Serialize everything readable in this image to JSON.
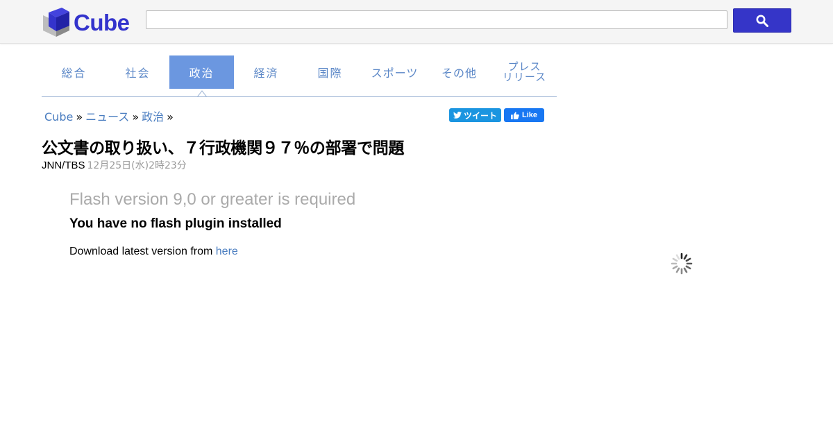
{
  "header": {
    "logo_text": "Cube",
    "search": {
      "value": "",
      "placeholder": ""
    },
    "brand_color": "#3535c8"
  },
  "nav": {
    "tabs": [
      {
        "label": "総合",
        "active": false
      },
      {
        "label": "社会",
        "active": false
      },
      {
        "label": "政治",
        "active": true
      },
      {
        "label": "経済",
        "active": false
      },
      {
        "label": "国際",
        "active": false
      },
      {
        "label": "スポーツ",
        "active": false
      },
      {
        "label": "その他",
        "active": false
      },
      {
        "label_line1": "プレス",
        "label_line2": "リリース",
        "active": false
      }
    ],
    "active_color": "#6b97e0",
    "text_color": "#5b87c7"
  },
  "breadcrumb": {
    "items": [
      "Cube",
      "ニュース",
      "政治"
    ],
    "separator": "»"
  },
  "social": {
    "tweet_label": "ツイート",
    "like_label": "Like"
  },
  "article": {
    "title": "公文書の取り扱い、７行政機関９７％の部署で問題",
    "source": "JNN/TBS",
    "date": "12月25日(水)2時23分"
  },
  "flash": {
    "heading": "Flash version 9,0 or greater is required",
    "subheading": "You have no flash plugin installed",
    "download_text": "Download latest version from",
    "download_link": "here"
  },
  "icons": [
    "cube-logo-icon",
    "search-icon",
    "twitter-bird-icon",
    "thumbs-up-icon",
    "loading-spinner-icon"
  ]
}
